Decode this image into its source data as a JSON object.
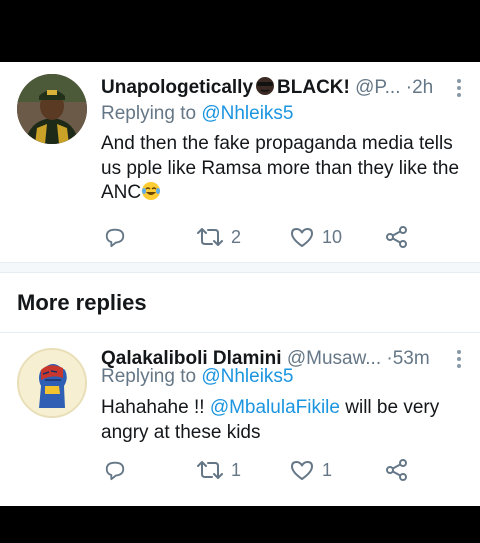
{
  "tweets": [
    {
      "name": "Unapologetically",
      "name_suffix": "BLACK!",
      "handle": "@P...",
      "time": "2h",
      "reply_prefix": "Replying to ",
      "reply_handle": "@Nhleiks5",
      "text": "And then the fake propaganda media tells us pple like Ramsa more than they like the ANC",
      "retweets": "2",
      "likes": "10"
    },
    {
      "name": "Qalakaliboli Dlamini",
      "handle": "@Musaw...",
      "time": "53m",
      "reply_prefix": "Replying to ",
      "reply_handle": "@Nhleiks5",
      "text_before": "Hahahahe !! ",
      "mention": "@MbalulaFikile",
      "text_after": " will be very angry at these kids",
      "retweets": "1",
      "likes": "1"
    }
  ],
  "section": {
    "more_replies": "More replies"
  },
  "colors": {
    "link": "#1b95e0",
    "secondary": "#657786",
    "text": "#14171a",
    "divider": "#e6ecf0"
  }
}
